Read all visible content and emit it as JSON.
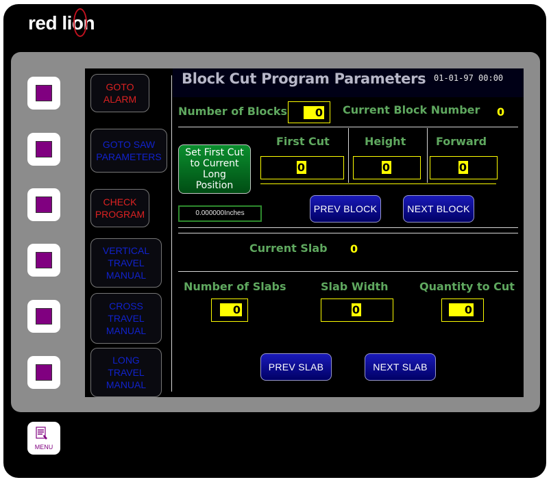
{
  "brand": {
    "name": "red lion"
  },
  "menu": {
    "label": "MENU"
  },
  "header": {
    "title": "Block Cut Program Parameters",
    "datetime": "01-01-97 00:00"
  },
  "softkeys": [
    {
      "line1": "GOTO",
      "line2": "ALARM",
      "line3": ""
    },
    {
      "line1": "GOTO SAW",
      "line2": "PARAMETERS",
      "line3": ""
    },
    {
      "line1": "CHECK",
      "line2": "PROGRAM",
      "line3": ""
    },
    {
      "line1": "VERTICAL",
      "line2": "TRAVEL",
      "line3": "MANUAL"
    },
    {
      "line1": "CROSS",
      "line2": "TRAVEL",
      "line3": "MANUAL"
    },
    {
      "line1": "LONG",
      "line2": "TRAVEL",
      "line3": "MANUAL"
    }
  ],
  "blocks": {
    "number_label": "Number of Blocks",
    "number_value": "0",
    "current_label": "Current Block Number",
    "current_value": "0"
  },
  "cut": {
    "set_btn": [
      "Set First Cut",
      "to Current",
      "Long",
      "Position"
    ],
    "first_cut_label": "First Cut",
    "first_cut_value": "0",
    "height_label": "Height",
    "height_value": "0",
    "forward_label": "Forward",
    "forward_value": "0",
    "position_value": "0.000000Inches",
    "prev_block": "PREV BLOCK",
    "next_block": "NEXT BLOCK"
  },
  "slab": {
    "current_label": "Current Slab",
    "current_value": "0",
    "num_label": "Number of Slabs",
    "num_value": "0",
    "width_label": "Slab Width",
    "width_value": "0",
    "qty_label": "Quantity to Cut",
    "qty_value": "0",
    "prev_slab": "PREV SLAB",
    "next_slab": "NEXT SLAB"
  },
  "colors": {
    "label_green": "#5fa85f",
    "value_yellow": "#ffff00",
    "softkey_purple": "#800080"
  }
}
